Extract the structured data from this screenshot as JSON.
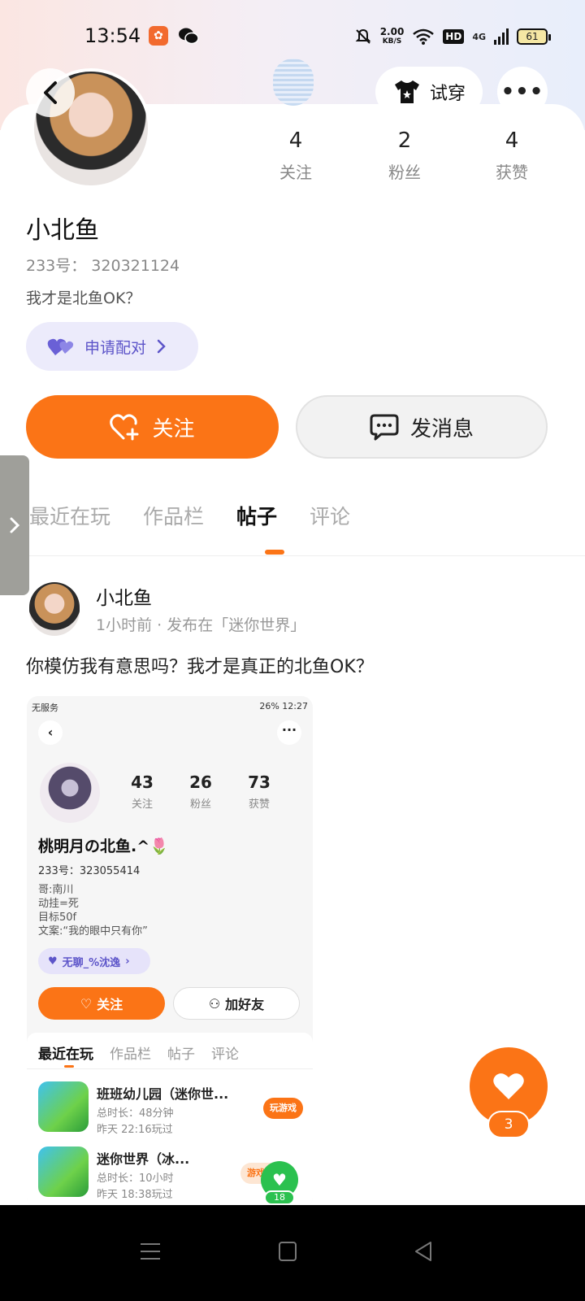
{
  "status_bar": {
    "time": "13:54",
    "net_speed_value": "2.00",
    "net_speed_unit": "KB/S",
    "hd": "HD",
    "signal_label": "4G",
    "battery": "61"
  },
  "header": {
    "tryon_label": "试穿",
    "more_label": "•••"
  },
  "profile": {
    "stats": [
      {
        "value": "4",
        "label": "关注"
      },
      {
        "value": "2",
        "label": "粉丝"
      },
      {
        "value": "4",
        "label": "获赞"
      }
    ],
    "username": "小北鱼",
    "uid": "233号： 320321124",
    "bio": "我才是北鱼OK？",
    "pair_label": "申请配对",
    "follow_label": "关注",
    "message_label": "发消息"
  },
  "tabs": [
    {
      "label": "最近在玩"
    },
    {
      "label": "作品栏"
    },
    {
      "label": "帖子"
    },
    {
      "label": "评论"
    }
  ],
  "post": {
    "author": "小北鱼",
    "meta": "1小时前 · 发布在「迷你世界」",
    "text": "你模仿我有意思吗？我才是真正的北鱼OK？",
    "like_count": "3"
  },
  "embedded": {
    "status_left": "无服务",
    "status_right": "26% 12:27",
    "stats": [
      {
        "value": "43",
        "label": "关注"
      },
      {
        "value": "26",
        "label": "粉丝"
      },
      {
        "value": "73",
        "label": "获赞"
      }
    ],
    "name": "桃明月の北鱼.^🌷",
    "uid": "233号：323055414",
    "bio_lines": [
      "哥:南川",
      "动挂=死",
      "目标50f",
      "文案:“我的眼中只有你”"
    ],
    "pair_label": "无聊_%沈逸",
    "follow_label": "关注",
    "add_friend_label": "加好友",
    "tabs": [
      "最近在玩",
      "作品栏",
      "帖子",
      "评论"
    ],
    "games": [
      {
        "title": "班班幼儿园（迷你世...",
        "duration": "总时长：48分钟",
        "last": "昨天 22:16玩过",
        "badge": "玩游戏"
      },
      {
        "title": "迷你世界（冰...",
        "duration": "总时长：10小时",
        "last": "昨天 18:38玩过",
        "badge": "游戏圈"
      }
    ],
    "like_count": "18"
  },
  "colors": {
    "accent": "#fb7416",
    "pair_purple": "#5d55c9",
    "green_like": "#2bc14f"
  }
}
